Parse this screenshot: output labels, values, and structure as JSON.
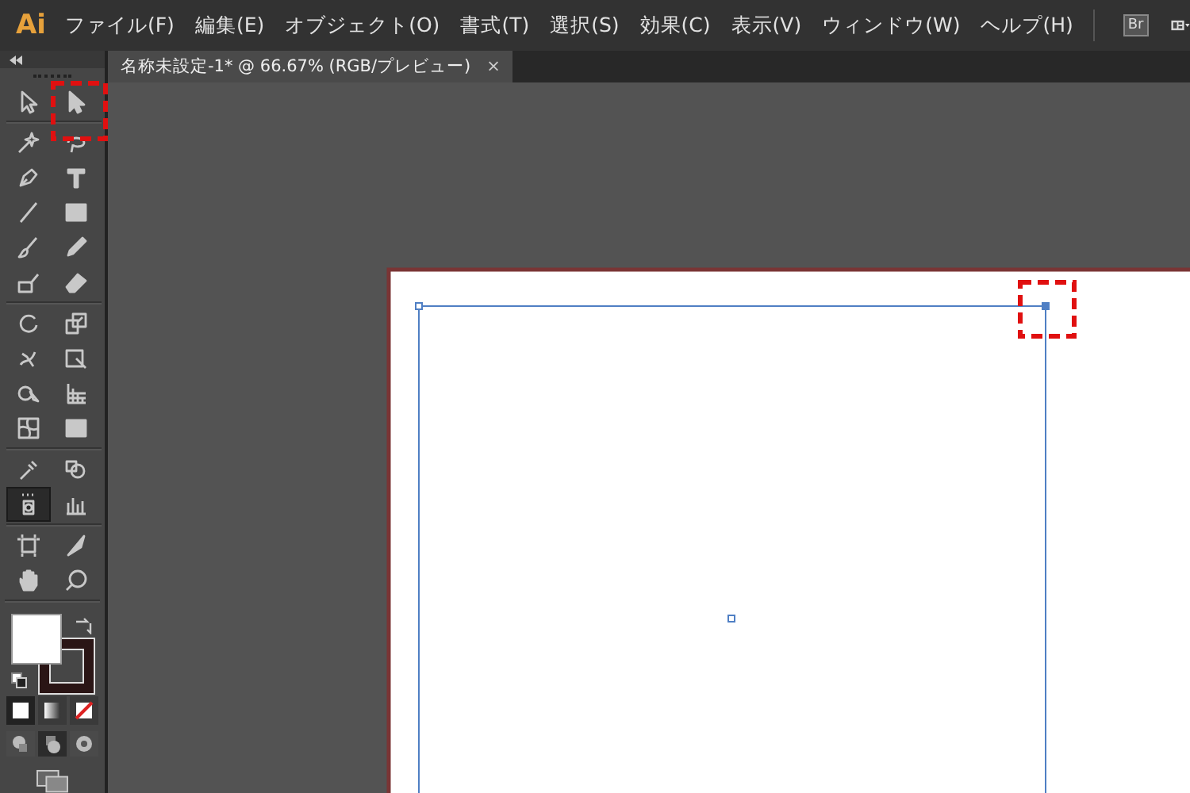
{
  "app": {
    "logo": "Ai"
  },
  "menu": [
    {
      "label": "ファイル(F)"
    },
    {
      "label": "編集(E)"
    },
    {
      "label": "オブジェクト(O)"
    },
    {
      "label": "書式(T)"
    },
    {
      "label": "選択(S)"
    },
    {
      "label": "効果(C)"
    },
    {
      "label": "表示(V)"
    },
    {
      "label": "ウィンドウ(W)"
    },
    {
      "label": "ヘルプ(H)"
    }
  ],
  "bridge_button": {
    "label": "Br"
  },
  "document_tab": {
    "title": "名称未設定-1* @ 66.67% (RGB/プレビュー)",
    "close": "×"
  },
  "tools": [
    {
      "selected": false
    },
    {
      "selected": false
    },
    {
      "selected": false
    },
    {
      "selected": false
    },
    {
      "selected": false
    },
    {
      "selected": false
    },
    {
      "selected": false
    },
    {
      "selected": false
    },
    {
      "selected": false
    },
    {
      "selected": false
    },
    {
      "selected": false
    },
    {
      "selected": false
    },
    {
      "selected": false
    },
    {
      "selected": false
    },
    {
      "selected": false
    },
    {
      "selected": false
    },
    {
      "selected": false
    },
    {
      "selected": false
    },
    {
      "selected": false
    },
    {
      "selected": false
    },
    {
      "selected": false
    },
    {
      "selected": false
    },
    {
      "selected": true
    },
    {
      "selected": false
    },
    {
      "selected": false
    },
    {
      "selected": false
    },
    {
      "selected": false
    },
    {
      "selected": false
    }
  ]
}
